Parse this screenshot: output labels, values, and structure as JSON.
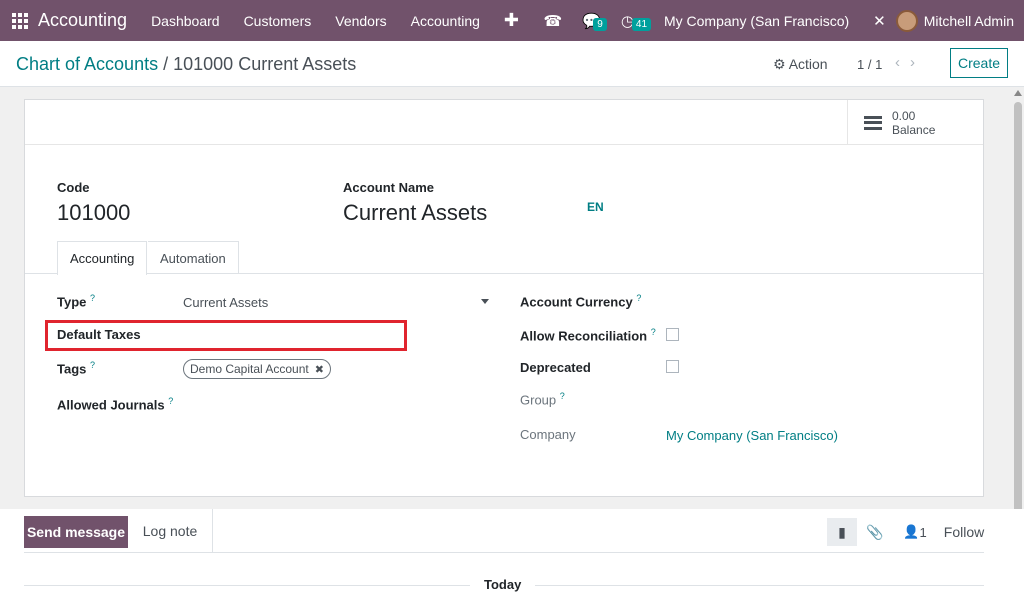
{
  "navbar": {
    "app_name": "Accounting",
    "menu": [
      "Dashboard",
      "Customers",
      "Vendors",
      "Accounting"
    ],
    "messages_count": "9",
    "activities_count": "41",
    "company": "My Company (San Francisco)",
    "user": "Mitchell Admin",
    "color": "#71526b"
  },
  "control": {
    "breadcrumb_parent": "Chart of Accounts",
    "breadcrumb_sep": "/",
    "breadcrumb_current": "101000 Current Assets",
    "action_label": "Action",
    "pager": "1 / 1",
    "create_label": "Create"
  },
  "form": {
    "balance_value": "0.00",
    "balance_label": "Balance",
    "code_label": "Code",
    "code_value": "101000",
    "name_label": "Account Name",
    "name_value": "Current Assets",
    "lang": "EN",
    "tabs": [
      "Accounting",
      "Automation"
    ],
    "type_label": "Type",
    "type_value": "Current Assets",
    "default_taxes_label": "Default Taxes",
    "tags_label": "Tags",
    "tag_value": "Demo Capital Account",
    "allowed_journals_label": "Allowed Journals",
    "currency_label": "Account Currency",
    "reconcile_label": "Allow Reconciliation",
    "deprecated_label": "Deprecated",
    "group_label": "Group",
    "company_label": "Company",
    "company_value": "My Company (San Francisco)",
    "help_mark": "?",
    "highlight_color": "#e0242e"
  },
  "chatter": {
    "send_label": "Send message",
    "log_label": "Log note",
    "followers_count": "1",
    "follow_label": "Follow",
    "today_label": "Today"
  }
}
